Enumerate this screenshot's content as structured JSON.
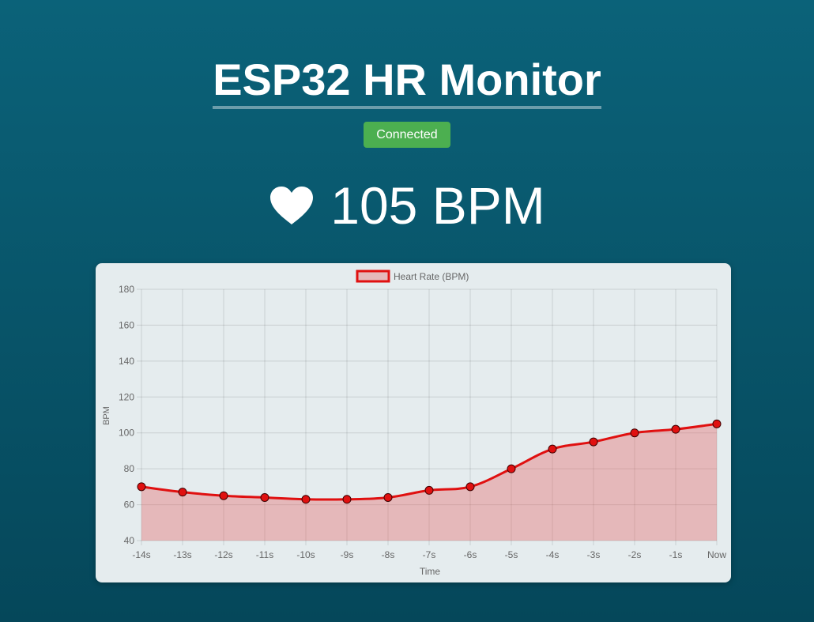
{
  "header": {
    "title": "ESP32 HR Monitor",
    "status": "Connected"
  },
  "reading": {
    "value": "105",
    "unit": "BPM",
    "display": "105 BPM",
    "icon": "heart-icon"
  },
  "colors": {
    "background_top": "#0b6279",
    "background_bottom": "#05475a",
    "status_badge": "#4caf50",
    "line": "#e01010",
    "fill": "rgba(230,90,90,0.35)",
    "point": "#e01010"
  },
  "chart_data": {
    "type": "line",
    "legend": "Heart Rate (BPM)",
    "legend_position": "top",
    "xlabel": "Time",
    "ylabel": "BPM",
    "ylim": [
      40,
      180
    ],
    "yticks": [
      40,
      60,
      80,
      100,
      120,
      140,
      160,
      180
    ],
    "grid": true,
    "filled": true,
    "categories": [
      "-14s",
      "-13s",
      "-12s",
      "-11s",
      "-10s",
      "-9s",
      "-8s",
      "-7s",
      "-6s",
      "-5s",
      "-4s",
      "-3s",
      "-2s",
      "-1s",
      "Now"
    ],
    "series": [
      {
        "name": "Heart Rate (BPM)",
        "values": [
          70,
          67,
          65,
          64,
          63,
          63,
          64,
          68,
          70,
          80,
          91,
          95,
          100,
          102,
          105
        ]
      }
    ]
  }
}
